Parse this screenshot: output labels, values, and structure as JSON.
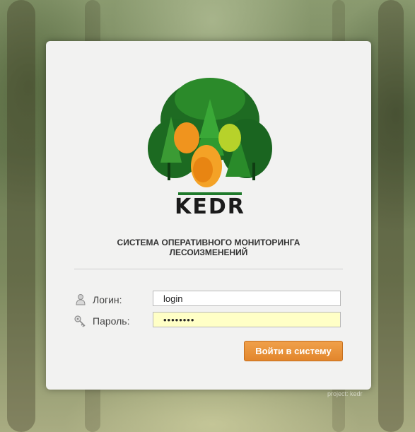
{
  "brand": {
    "logo_text": "KEDR",
    "subtitle_line1": "СИСТЕМА ОПЕРАТИВНОГО МОНИТОРИНГА",
    "subtitle_line2": "ЛЕСОИЗМЕНЕНИЙ"
  },
  "form": {
    "login_label": "Логин:",
    "login_value": "login",
    "password_label": "Пароль:",
    "password_value": "••••••••",
    "submit_label": "Войти в систему"
  },
  "icons": {
    "login": "user-icon",
    "password": "key-icon"
  },
  "colors": {
    "accent_button": "#e8922f",
    "password_field_bg": "#ffffc6",
    "brand_green": "#1f7a2b"
  },
  "footer": {
    "text": "project: kedr"
  }
}
